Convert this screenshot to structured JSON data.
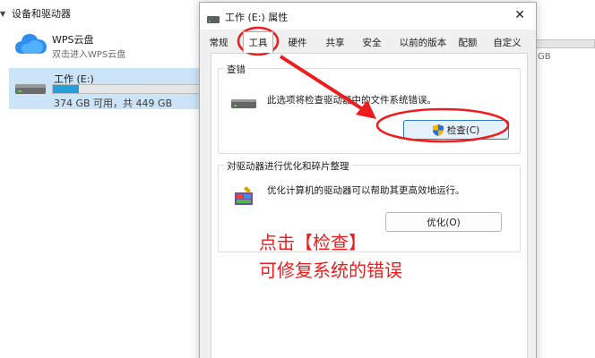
{
  "explorer": {
    "section_title": "设备和驱动器",
    "wps": {
      "name": "WPS云盘",
      "subtitle": "双击进入WPS云盘"
    },
    "drive": {
      "name": "工作 (E:)",
      "size_text": "374 GB 可用，共 449 GB",
      "used_fraction": 0.17
    },
    "right_size_fragment": "GB"
  },
  "dialog": {
    "title": "工作 (E:) 属性",
    "tabs": [
      "常规",
      "工具",
      "硬件",
      "共享",
      "安全",
      "以前的版本",
      "配额",
      "自定义"
    ],
    "active_tab": "工具",
    "error_check": {
      "title": "查错",
      "description": "此选项将检查驱动器中的文件系统错误。",
      "button": "检查(C)"
    },
    "optimize": {
      "title": "对驱动器进行优化和碎片整理",
      "description": "优化计算机的驱动器可以帮助其更高效地运行。",
      "button": "优化(O)"
    }
  },
  "annotation": {
    "line1": "点击【检查】",
    "line2": "可修复系统的错误",
    "color": "#ee1c1c"
  },
  "icons": [
    "chevron-down-icon",
    "cloud-icon",
    "drive-icon",
    "defrag-icon",
    "shield-icon",
    "close-icon"
  ]
}
